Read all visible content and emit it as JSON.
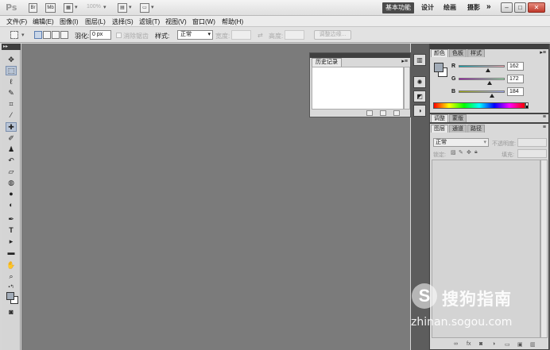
{
  "titlebar": {
    "app_logo": "Ps",
    "zoom": "100%",
    "workspaces": [
      "基本功能",
      "设计",
      "绘画",
      "摄影"
    ],
    "more": "»",
    "window_controls": [
      "–",
      "□",
      "✕"
    ]
  },
  "menu": [
    "文件(F)",
    "编辑(E)",
    "图像(I)",
    "图层(L)",
    "选择(S)",
    "滤镜(T)",
    "视图(V)",
    "窗口(W)",
    "帮助(H)"
  ],
  "options": {
    "feather_label": "羽化:",
    "feather_value": "0 px",
    "antialias_label": "消除锯齿",
    "style_label": "样式:",
    "style_value": "正常",
    "width_label": "宽度:",
    "height_label": "高度:",
    "refine_edge": "调整边缘..."
  },
  "history_panel": {
    "tab": "历史记录",
    "menu_icon": "▸≡"
  },
  "color_panel": {
    "tabs": [
      "颜色",
      "色板",
      "样式"
    ],
    "channels": [
      {
        "label": "R",
        "value": "162",
        "fraction": 0.635
      },
      {
        "label": "G",
        "value": "172",
        "fraction": 0.675
      },
      {
        "label": "B",
        "value": "184",
        "fraction": 0.722
      }
    ],
    "fg_color": "#a2acb8",
    "bg_color": "#ffffff"
  },
  "adjust_panel": {
    "tabs": [
      "调整",
      "蒙版"
    ]
  },
  "layers_panel": {
    "tabs": [
      "图层",
      "通道",
      "路径"
    ],
    "blend_mode": "正常",
    "opacity_label": "不透明度:",
    "lock_label": "锁定:",
    "fill_label": "填充:"
  },
  "watermark": {
    "logo": "S",
    "text": "搜狗指南",
    "url": "zhinan.sogou.com"
  },
  "colors": {
    "canvas": "#7b7b7b",
    "panel_bg": "#d9d9d9",
    "dock": "#5d5d5d"
  }
}
